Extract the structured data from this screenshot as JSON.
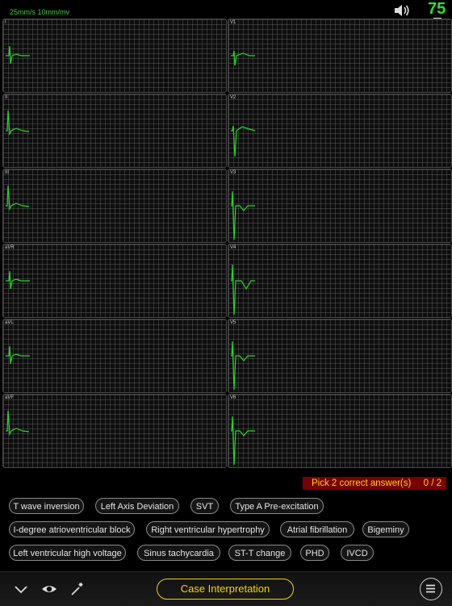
{
  "header": {
    "speed": "25mm/s  10mm/mv",
    "count": "75",
    "sound_icon": "speaker-icon",
    "bookmark_icon": "bookmark-icon"
  },
  "leads": [
    {
      "label": "I",
      "trace": "small-r"
    },
    {
      "label": "V1",
      "trace": "rs"
    },
    {
      "label": "II",
      "trace": "tall-r"
    },
    {
      "label": "V2",
      "trace": "deep-s"
    },
    {
      "label": "III",
      "trace": "tall-r"
    },
    {
      "label": "V3",
      "trace": "big-rs"
    },
    {
      "label": "aVR",
      "trace": "small-r"
    },
    {
      "label": "V4",
      "trace": "big-rs-t"
    },
    {
      "label": "aVL",
      "trace": "small-r"
    },
    {
      "label": "V5",
      "trace": "big-rs"
    },
    {
      "label": "aVF",
      "trace": "tall-r"
    },
    {
      "label": "V6",
      "trace": "big-rs"
    }
  ],
  "quiz": {
    "prompt": "Pick 2 correct answer(s)",
    "score": "0 / 2"
  },
  "answers": [
    "T wave inversion",
    "Left Axis Deviation",
    "SVT",
    "Type A Pre-excitation",
    "I-degree atrioventricular block",
    "Right ventricular hypertrophy",
    "Atrial fibrillation",
    "Bigeminy",
    "Left ventricular high voltage",
    "Sinus tachycardia",
    "ST-T change",
    "PHD",
    "IVCD"
  ],
  "bottom": {
    "case_button": "Case Interpretation",
    "icons": [
      "chevron-down-icon",
      "eye-icon",
      "magic-wand-icon",
      "menu-icon"
    ]
  },
  "colors": {
    "trace": "#22dd22",
    "accent": "#f2d500",
    "prompt_bg": "#7a0000"
  }
}
